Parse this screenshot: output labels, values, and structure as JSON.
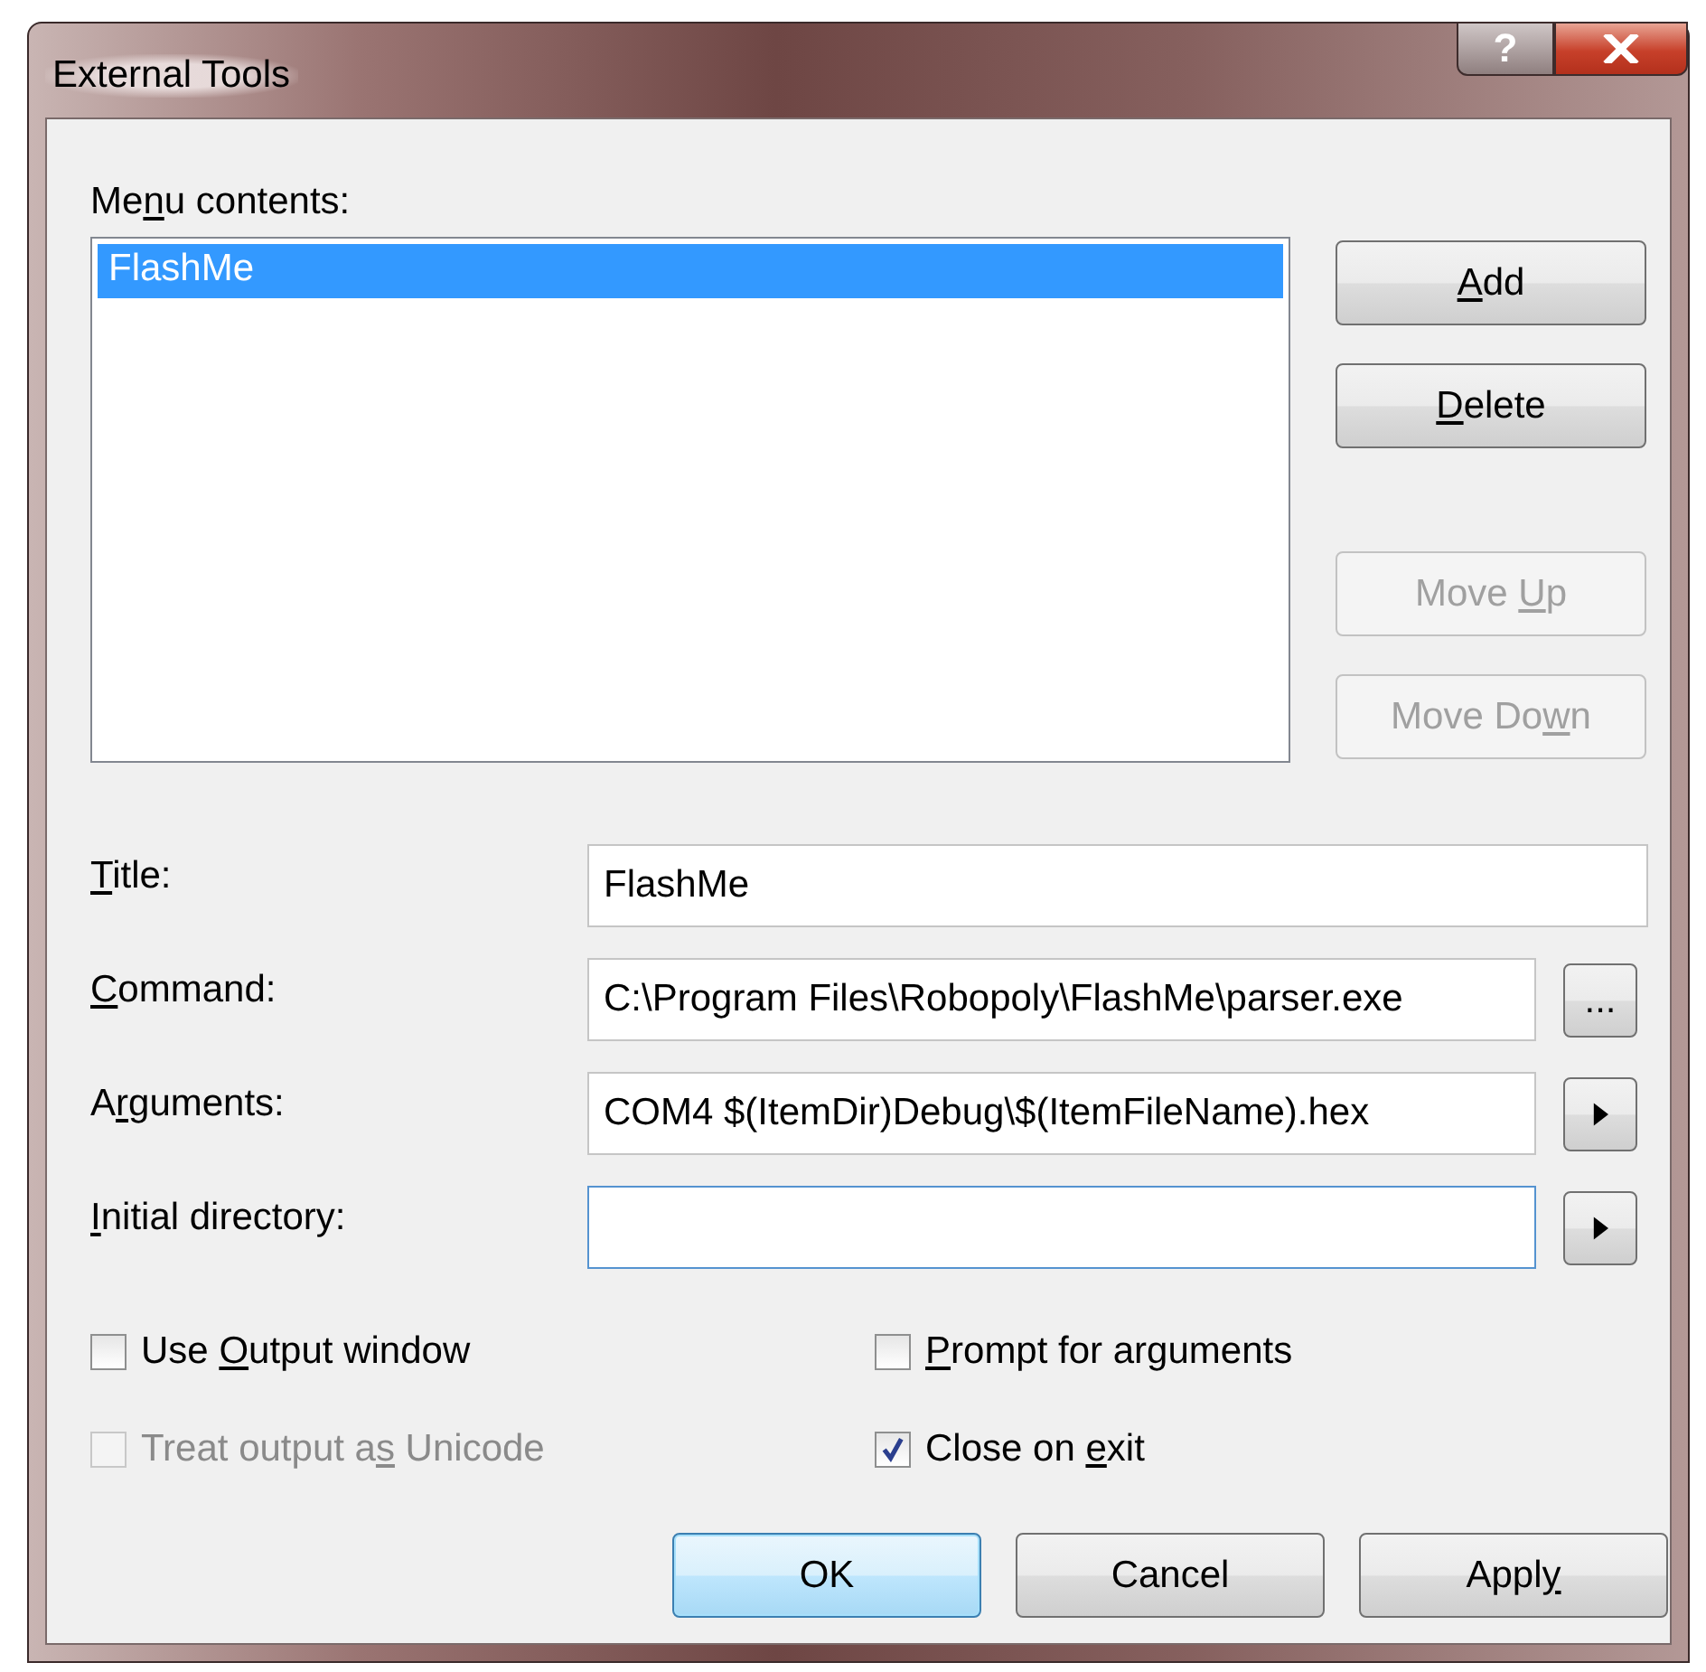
{
  "window": {
    "title": "External Tools",
    "help_button": "?"
  },
  "menu_contents": {
    "label": [
      {
        "text": "Me"
      },
      {
        "text": "n",
        "underlined": true
      },
      {
        "text": "u contents:"
      }
    ],
    "items": [
      {
        "text": "FlashMe",
        "selected": true
      }
    ]
  },
  "list_buttons": [
    {
      "label": [
        {
          "text": "A",
          "underlined": true
        },
        {
          "text": "dd"
        }
      ],
      "disabled": false
    },
    {
      "label": [
        {
          "text": "D",
          "underlined": true
        },
        {
          "text": "elete"
        }
      ],
      "disabled": false
    },
    {
      "label": [
        {
          "text": "Move "
        },
        {
          "text": "U",
          "underlined": true
        },
        {
          "text": "p"
        }
      ],
      "disabled": true
    },
    {
      "label": [
        {
          "text": "Move Do"
        },
        {
          "text": "w",
          "underlined": true
        },
        {
          "text": "n"
        }
      ],
      "disabled": true
    }
  ],
  "fields": [
    {
      "kind": "plain",
      "label": [
        {
          "text": "T",
          "underlined": true
        },
        {
          "text": "itle:"
        }
      ],
      "value": "FlashMe",
      "focused": false
    },
    {
      "kind": "browse",
      "label": [
        {
          "text": "C",
          "underlined": true
        },
        {
          "text": "ommand:"
        }
      ],
      "value": "C:\\Program Files\\Robopoly\\FlashMe\\parser.exe",
      "button": "...",
      "focused": false
    },
    {
      "kind": "menu",
      "label": [
        {
          "text": "A"
        },
        {
          "text": "r",
          "underlined": true
        },
        {
          "text": "guments:"
        }
      ],
      "value": "COM4 $(ItemDir)Debug\\$(ItemFileName).hex",
      "focused": false
    },
    {
      "kind": "menu",
      "label": [
        {
          "text": "I",
          "underlined": true
        },
        {
          "text": "nitial directory:"
        }
      ],
      "focused": true
    }
  ],
  "options": [
    {
      "label": [
        {
          "text": "Use "
        },
        {
          "text": "O",
          "underlined": true
        },
        {
          "text": "utput window"
        }
      ],
      "checked": false,
      "disabled": false
    },
    {
      "label": [
        {
          "text": "P",
          "underlined": true
        },
        {
          "text": "rompt for arguments"
        }
      ],
      "checked": false,
      "disabled": false
    },
    {
      "label": [
        {
          "text": "Treat output a"
        },
        {
          "text": "s",
          "underlined": true
        },
        {
          "text": " Unicode"
        }
      ],
      "checked": false,
      "disabled": true
    },
    {
      "label": [
        {
          "text": "Close on "
        },
        {
          "text": "e",
          "underlined": true
        },
        {
          "text": "xit"
        }
      ],
      "checked": true,
      "disabled": false
    }
  ],
  "dialog_buttons": [
    {
      "label": [
        {
          "text": "OK"
        }
      ],
      "default": true
    },
    {
      "label": [
        {
          "text": "Cancel"
        }
      ],
      "default": false
    },
    {
      "label": [
        {
          "text": "Appl"
        },
        {
          "text": "y",
          "underlined": true
        }
      ],
      "default": false
    }
  ]
}
